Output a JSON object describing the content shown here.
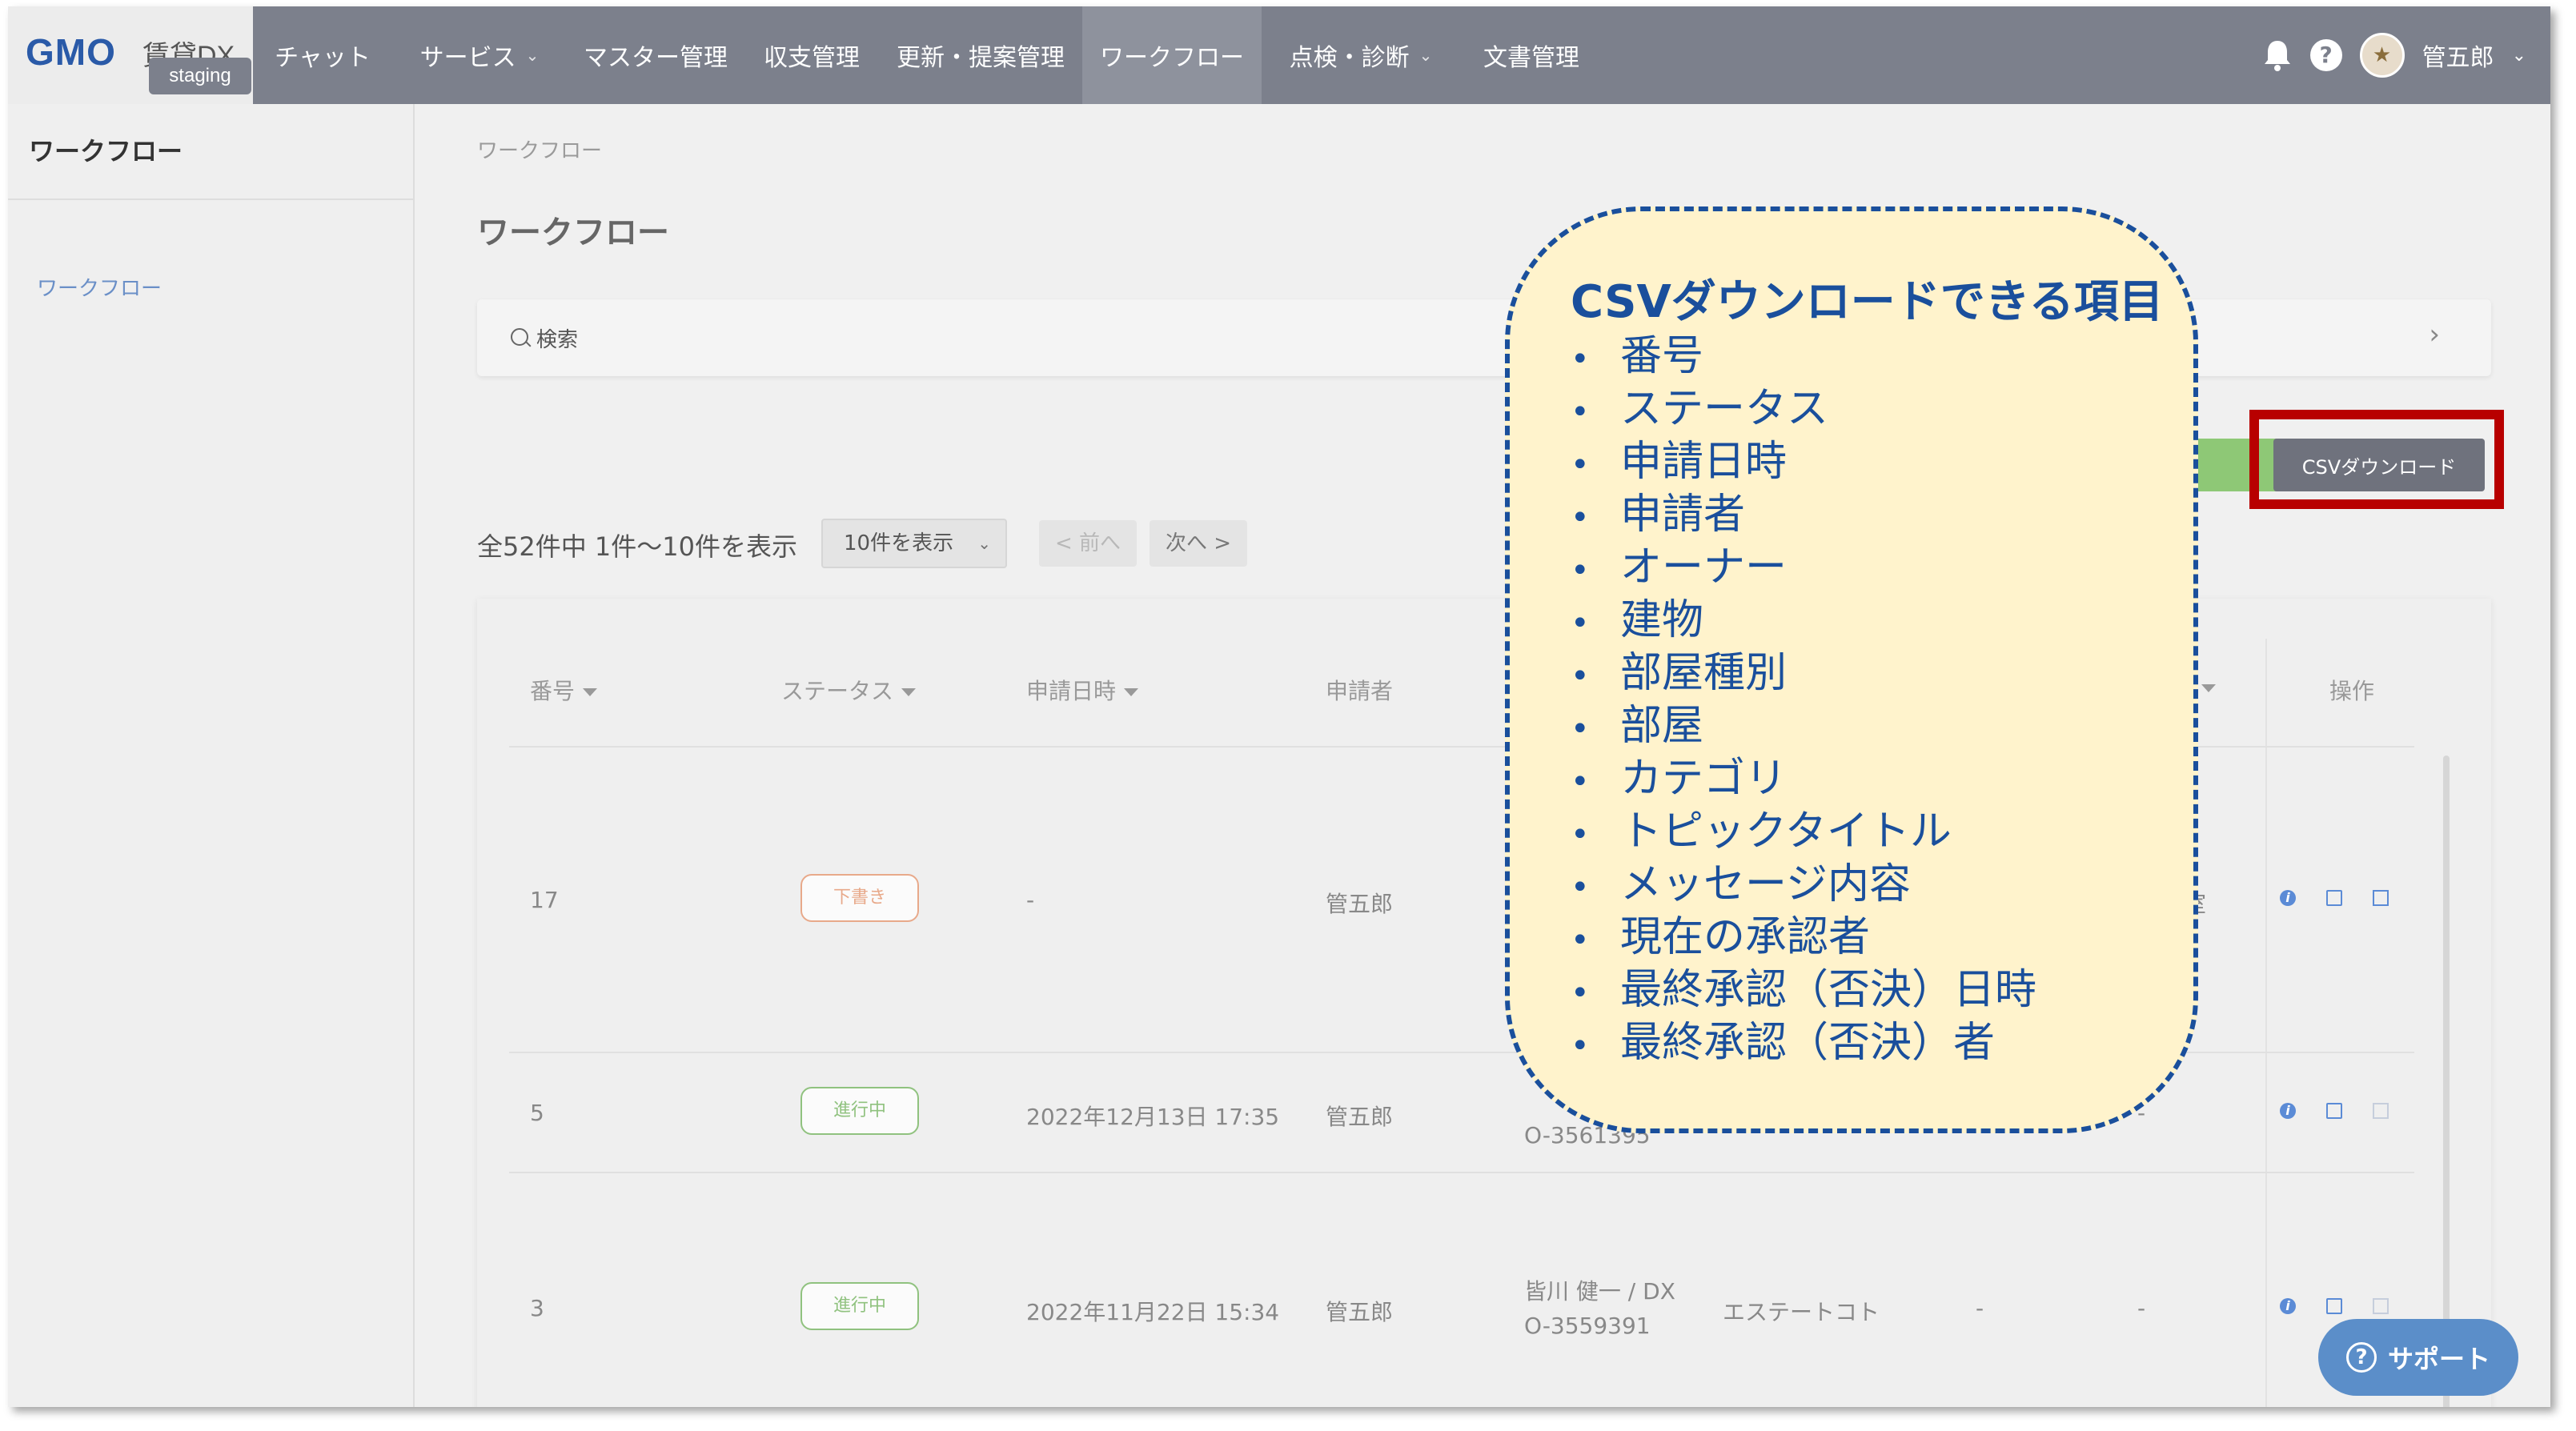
{
  "header": {
    "logo_gmo": "GMO",
    "logo_product": "賃貸DX",
    "env_badge": "staging",
    "nav": [
      {
        "label": "チャット",
        "dropdown": false,
        "active": false
      },
      {
        "label": "サービス",
        "dropdown": true,
        "active": false
      },
      {
        "label": "マスター管理",
        "dropdown": false,
        "active": false
      },
      {
        "label": "収支管理",
        "dropdown": false,
        "active": false
      },
      {
        "label": "更新・提案管理",
        "dropdown": false,
        "active": false
      },
      {
        "label": "ワークフロー",
        "dropdown": false,
        "active": true
      },
      {
        "label": "点検・診断",
        "dropdown": true,
        "active": false
      },
      {
        "label": "文書管理",
        "dropdown": false,
        "active": false
      }
    ],
    "help_glyph": "?",
    "user_name": "管五郎"
  },
  "sidebar": {
    "title": "ワークフロー",
    "items": [
      {
        "label": "ワークフロー"
      }
    ]
  },
  "main": {
    "breadcrumb": "ワークフロー",
    "page_title": "ワークフロー",
    "search_label": "検索",
    "csv_button": "CSVダウンロード",
    "count_text": "全52件中 1件～10件を表示",
    "per_page": "10件を表示",
    "prev": "< 前へ",
    "next": "次へ >"
  },
  "table": {
    "headers": {
      "number": "番号",
      "status": "ステータス",
      "applied_at": "申請日時",
      "applicant": "申請者",
      "operations": "操作"
    },
    "rows": [
      {
        "number": "17",
        "status": "下書き",
        "status_type": "draft",
        "applied_at": "-",
        "applicant": "管五郎",
        "owner_line1": "",
        "owner_line2": "",
        "building": "",
        "col_a": "",
        "room": "号室"
      },
      {
        "number": "5",
        "status": "進行中",
        "status_type": "progress",
        "applied_at": "2022年12月13日 17:35",
        "applicant": "管五郎",
        "owner_line1": "",
        "owner_line2": "O-3561395",
        "building": "",
        "col_a": "",
        "room": "-"
      },
      {
        "number": "3",
        "status": "進行中",
        "status_type": "progress",
        "applied_at": "2022年11月22日 15:34",
        "applicant": "管五郎",
        "owner_line1": "皆川 健一 / DX",
        "owner_line2": "O-3559391",
        "building": "エステートコト",
        "col_a": "-",
        "room": "-"
      }
    ]
  },
  "support_label": "サポート",
  "callout": {
    "title": "CSVダウンロードできる項目",
    "items": [
      "番号",
      "ステータス",
      "申請日時",
      "申請者",
      "オーナー",
      "建物",
      "部屋種別",
      "部屋",
      "カテゴリ",
      "トピックタイトル",
      "メッセージ内容",
      "現在の承認者",
      "最終承認（否決）日時",
      "最終承認（否決）者"
    ]
  },
  "colors": {
    "nav_bg": "#7c808c",
    "accent_blue": "#1a4f9c",
    "callout_bg": "#fff3cc",
    "highlight_red": "#b80000",
    "draft": "#e8a98a",
    "progress": "#90c27f"
  }
}
